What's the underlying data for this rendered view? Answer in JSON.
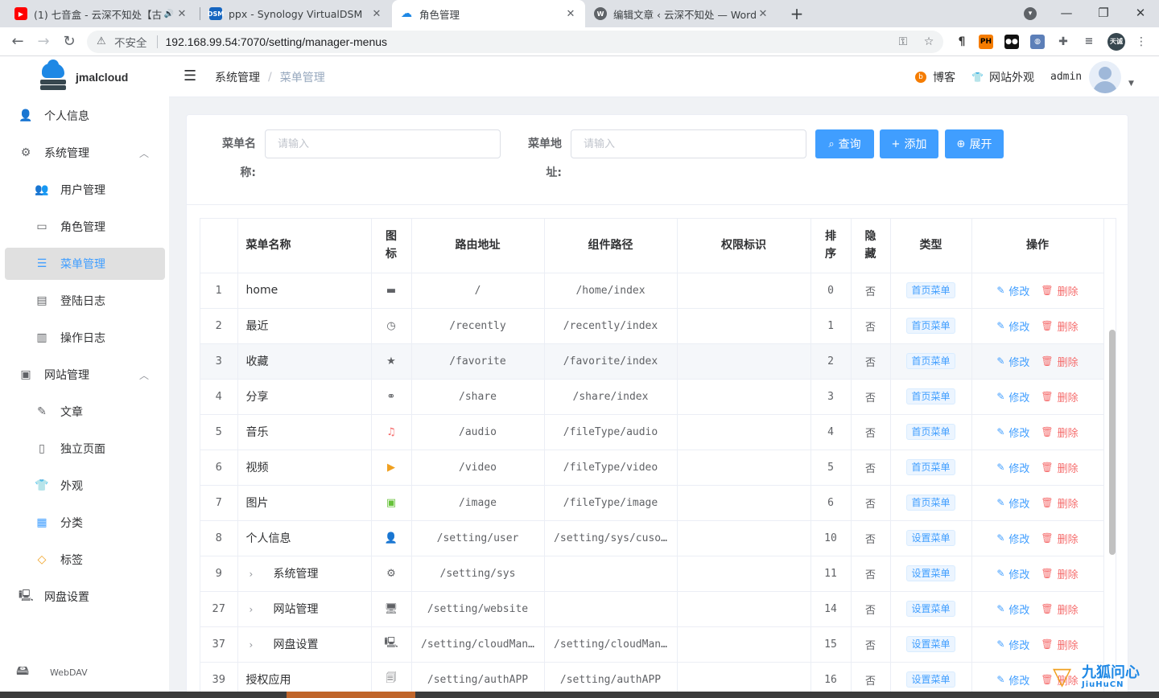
{
  "browser": {
    "tabs": [
      {
        "title": "(1) 七音盒 - 云深不知处【古",
        "favicon_color": "#ff0000",
        "favicon_glyph": "▶"
      },
      {
        "title": "ppx - Synology VirtualDSM",
        "favicon_color": "#1565c0",
        "favicon_glyph": "DSM"
      },
      {
        "title": "角色管理",
        "favicon_color": "#1e88e5",
        "favicon_glyph": "☁"
      },
      {
        "title": "编辑文章 ‹ 云深不知处 — WordPress",
        "favicon_color": "#5f6368",
        "favicon_glyph": "W"
      }
    ],
    "insecure_label": "不安全",
    "url": "192.168.99.54:7070/setting/manager-menus",
    "profile_label": "天诚"
  },
  "sidebar": {
    "logo_text": "jmalcloud",
    "items": [
      {
        "label": "个人信息",
        "icon": "user-icon",
        "glyph": "👤"
      },
      {
        "label": "系统管理",
        "icon": "gear-icon",
        "glyph": "⚙"
      },
      {
        "label": "用户管理",
        "icon": "users-icon",
        "glyph": "👥"
      },
      {
        "label": "角色管理",
        "icon": "id-card-icon",
        "glyph": "🪪"
      },
      {
        "label": "菜单管理",
        "icon": "sliders-icon",
        "glyph": "☰"
      },
      {
        "label": "登陆日志",
        "icon": "log-icon",
        "glyph": "🗒"
      },
      {
        "label": "操作日志",
        "icon": "doc-icon",
        "glyph": "🗎"
      },
      {
        "label": "网站管理",
        "icon": "monitor-icon",
        "glyph": "🖥"
      },
      {
        "label": "文章",
        "icon": "article-icon",
        "glyph": "✎"
      },
      {
        "label": "独立页面",
        "icon": "page-icon",
        "glyph": "🗋"
      },
      {
        "label": "外观",
        "icon": "shirt-icon",
        "glyph": "👕"
      },
      {
        "label": "分类",
        "icon": "category-icon",
        "glyph": "▦"
      },
      {
        "label": "标签",
        "icon": "tag-icon",
        "glyph": "◇"
      },
      {
        "label": "网盘设置",
        "icon": "cloud-settings-icon",
        "glyph": "🖳"
      }
    ],
    "webdav_label": "WebDAV"
  },
  "topbar": {
    "breadcrumb_1": "系统管理",
    "breadcrumb_sep": "/",
    "breadcrumb_2": "菜单管理",
    "blog_label": "博客",
    "appearance_label": "网站外观",
    "user": "admin"
  },
  "search": {
    "name_label_1": "菜单名",
    "name_label_2": "称:",
    "name_placeholder": "请输入",
    "path_label_1": "菜单地",
    "path_label_2": "址:",
    "path_placeholder": "请输入",
    "query_btn": "查询",
    "add_btn": "添加",
    "expand_btn": "展开"
  },
  "table": {
    "headers": {
      "name": "菜单名称",
      "icon_1": "图",
      "icon_2": "标",
      "route": "路由地址",
      "component": "组件路径",
      "perm": "权限标识",
      "sort_1": "排",
      "sort_2": "序",
      "hidden_1": "隐",
      "hidden_2": "藏",
      "type": "类型",
      "ops": "操作"
    },
    "edit_label": "修改",
    "delete_label": "删除",
    "rows": [
      {
        "id": "1",
        "name": "home",
        "icon": "folder-icon",
        "glyph": "▬",
        "route": "/",
        "component": "/home/index",
        "perm": "",
        "sort": "0",
        "hidden": "否",
        "type": "首页菜单",
        "expandable": false
      },
      {
        "id": "2",
        "name": "最近",
        "icon": "clock-icon",
        "glyph": "◷",
        "route": "/recently",
        "component": "/recently/index",
        "perm": "",
        "sort": "1",
        "hidden": "否",
        "type": "首页菜单",
        "expandable": false
      },
      {
        "id": "3",
        "name": "收藏",
        "icon": "star-icon",
        "glyph": "★",
        "route": "/favorite",
        "component": "/favorite/index",
        "perm": "",
        "sort": "2",
        "hidden": "否",
        "type": "首页菜单",
        "expandable": false
      },
      {
        "id": "4",
        "name": "分享",
        "icon": "share-icon",
        "glyph": "⚭",
        "route": "/share",
        "component": "/share/index",
        "perm": "",
        "sort": "3",
        "hidden": "否",
        "type": "首页菜单",
        "expandable": false
      },
      {
        "id": "5",
        "name": "音乐",
        "icon": "audio-file-icon",
        "glyph": "♫",
        "route": "/audio",
        "component": "/fileType/audio",
        "perm": "",
        "sort": "4",
        "hidden": "否",
        "type": "首页菜单",
        "expandable": false
      },
      {
        "id": "6",
        "name": "视频",
        "icon": "video-file-icon",
        "glyph": "▶",
        "route": "/video",
        "component": "/fileType/video",
        "perm": "",
        "sort": "5",
        "hidden": "否",
        "type": "首页菜单",
        "expandable": false
      },
      {
        "id": "7",
        "name": "图片",
        "icon": "image-icon",
        "glyph": "▣",
        "route": "/image",
        "component": "/fileType/image",
        "perm": "",
        "sort": "6",
        "hidden": "否",
        "type": "首页菜单",
        "expandable": false
      },
      {
        "id": "8",
        "name": "个人信息",
        "icon": "user-icon",
        "glyph": "👤",
        "route": "/setting/user",
        "component": "/setting/sys/cuso…",
        "perm": "",
        "sort": "10",
        "hidden": "否",
        "type": "设置菜单",
        "expandable": false
      },
      {
        "id": "9",
        "name": "系统管理",
        "icon": "gear-icon",
        "glyph": "⚙",
        "route": "/setting/sys",
        "component": "",
        "perm": "",
        "sort": "11",
        "hidden": "否",
        "type": "设置菜单",
        "expandable": true
      },
      {
        "id": "27",
        "name": "网站管理",
        "icon": "monitor-icon",
        "glyph": "🖥",
        "route": "/setting/website",
        "component": "",
        "perm": "",
        "sort": "14",
        "hidden": "否",
        "type": "设置菜单",
        "expandable": true
      },
      {
        "id": "37",
        "name": "网盘设置",
        "icon": "cloud-settings-icon",
        "glyph": "🖳",
        "route": "/setting/cloudMan…",
        "component": "/setting/cloudMan…",
        "perm": "",
        "sort": "15",
        "hidden": "否",
        "type": "设置菜单",
        "expandable": true
      },
      {
        "id": "39",
        "name": "授权应用",
        "icon": "app-icon",
        "glyph": "🗐",
        "route": "/setting/authAPP",
        "component": "/setting/authAPP",
        "perm": "",
        "sort": "16",
        "hidden": "否",
        "type": "设置菜单",
        "expandable": false
      }
    ]
  },
  "watermark": {
    "title": "九狐问心",
    "subtitle": "JiuHuCN"
  },
  "colors": {
    "primary": "#409eff",
    "danger": "#f56c6c",
    "active_bg": "#e0e0e0"
  }
}
